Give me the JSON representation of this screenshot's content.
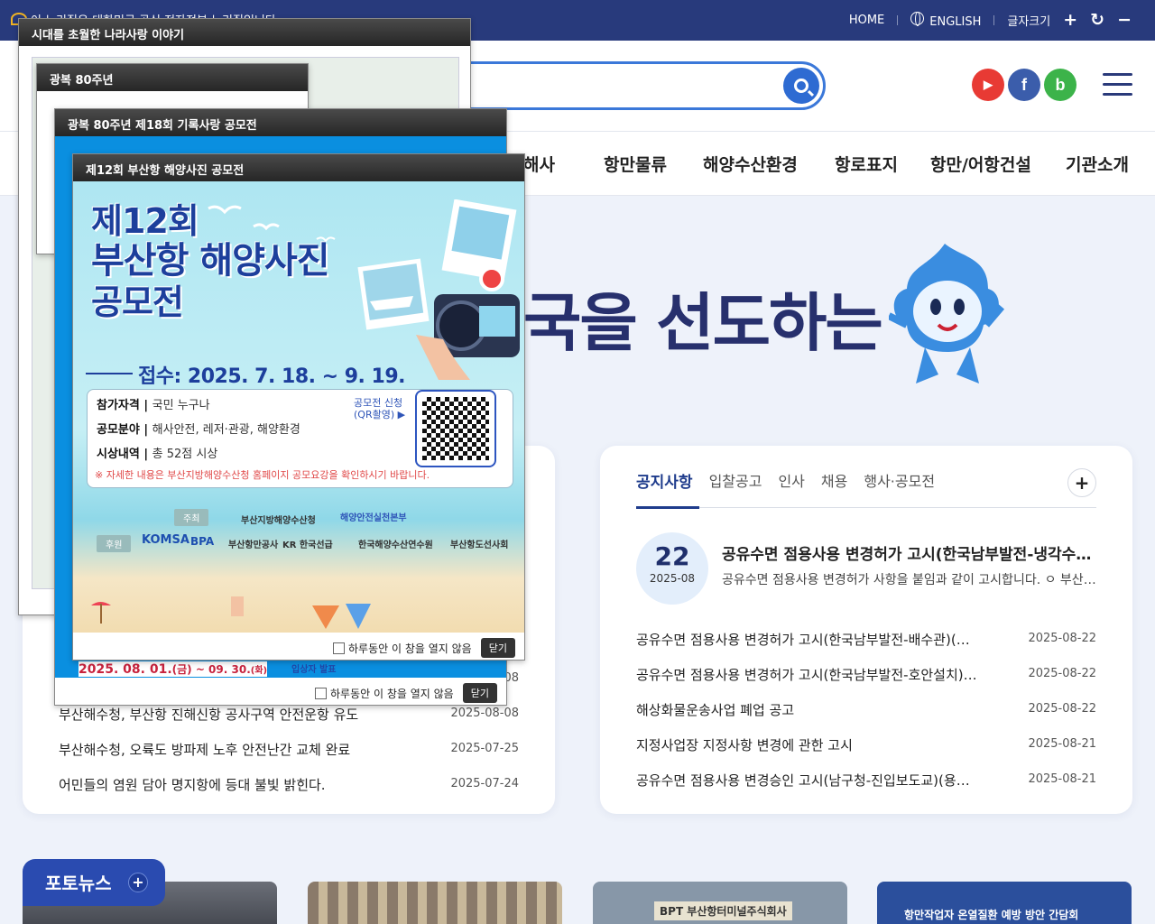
{
  "topbar": {
    "gov_text": "이 누리집은 대한민국 공식 전자정부 누리집입니다.",
    "home": "HOME",
    "english": "ENGLISH",
    "font_size": "글자크기",
    "plus": "+",
    "reset": "↻",
    "minus": "−"
  },
  "header": {
    "search_placeholder": "",
    "sns": [
      {
        "name": "youtube",
        "glyph": "▶",
        "color": "#e83a34"
      },
      {
        "name": "facebook",
        "glyph": "f",
        "color": "#3b5dab"
      },
      {
        "name": "blog",
        "glyph": "b",
        "color": "#3cb34a"
      }
    ]
  },
  "gnb": {
    "items": [
      "해사",
      "항만물류",
      "해양수산환경",
      "항로표지",
      "항만/어항건설",
      "기관소개"
    ]
  },
  "hero": {
    "text": "국을 선도하는"
  },
  "press": {
    "rows": [
      {
        "title": "",
        "date": "2025-08-08"
      },
      {
        "title": "부산해수청, 부산항 진해신항 공사구역 안전운항 유도",
        "date": "2025-08-08"
      },
      {
        "title": "부산해수청, 오륙도 방파제 노후 안전난간 교체 완료",
        "date": "2025-07-25"
      },
      {
        "title": "어민들의 염원 담아 명지항에 등대 불빛 밝힌다.",
        "date": "2025-07-24"
      }
    ]
  },
  "notice": {
    "tabs": [
      "공지사항",
      "입찰공고",
      "인사",
      "채용",
      "행사·공모전"
    ],
    "more": "+",
    "featured": {
      "day": "22",
      "month": "2025-08",
      "title": "공유수면 점용사용 변경허가 고시(한국남부발전-냉각수관)",
      "desc": "공유수면 점용사용 변경허가 사항을 붙임과 같이 고시합니다. ㅇ 부산광역시"
    },
    "rows": [
      {
        "title": "공유수면 점용사용 변경허가 고시(한국남부발전-배수관)(감천동 일원)",
        "date": "2025-08-22"
      },
      {
        "title": "공유수면 점용사용 변경허가 고시(한국남부발전-호안설치)(감천동)",
        "date": "2025-08-22"
      },
      {
        "title": "해상화물운송사업 폐업 공고",
        "date": "2025-08-22"
      },
      {
        "title": "지정사업장 지정사항 변경에 관한 고시",
        "date": "2025-08-21"
      },
      {
        "title": "공유수면 점용사용 변경승인 고시(남구청-진입보도교)(용호동)",
        "date": "2025-08-21"
      }
    ]
  },
  "photo": {
    "title": "포토뉴스",
    "more": "+",
    "thumb3": "BPT 부산항터미널주식회사",
    "thumb4": "항만작업자 온열질환 예방 방안 간담회"
  },
  "popups": {
    "p1": {
      "title": "시대를 초월한 나라사랑 이야기"
    },
    "p2": {
      "title": "광복 80주년"
    },
    "p3": {
      "title": "광복 80주년 제18회 기록사랑 공모전",
      "dates": "2025. 08. 01.",
      "dates_mid": "(금) ~ 09. 30.",
      "dates_end": "(화)",
      "award": "입상자 발표",
      "no_show": "하루동안 이 창을 열지 않음",
      "close": "닫기"
    },
    "p4": {
      "title": "제12회 부산항 해양사진 공모전",
      "poster_line1": "제12회",
      "poster_line2": "부산항 해양사진",
      "poster_line3": "공모전",
      "receipt": "접수: 2025. 7. 18. ~ 9. 19.",
      "eligibility_label": "참가자격 |",
      "eligibility": "국민 누구나",
      "field_label": "공모분야 |",
      "field": "해사안전, 레저·관광, 해양환경",
      "prize_label": "시상내역 |",
      "prize": "총 52점 시상",
      "qr_label": "공모전 신청 (QR촬영) ▶",
      "note": "※ 자세한 내용은 부산지방해양수산청 홈페이지 공모요강을 확인하시기 바랍니다.",
      "host_tag": "주최",
      "host1": "부산지방해양수산청",
      "host2": "해양안전실천본부",
      "sponsor_tag": "후원",
      "sponsors": [
        "KOMSA",
        "BPA",
        "부산항만공사",
        "KR 한국선급",
        "한국해양수산연수원",
        "부산항도선사회"
      ],
      "no_show": "하루동안 이 창을 열지 않음",
      "close": "닫기"
    }
  }
}
